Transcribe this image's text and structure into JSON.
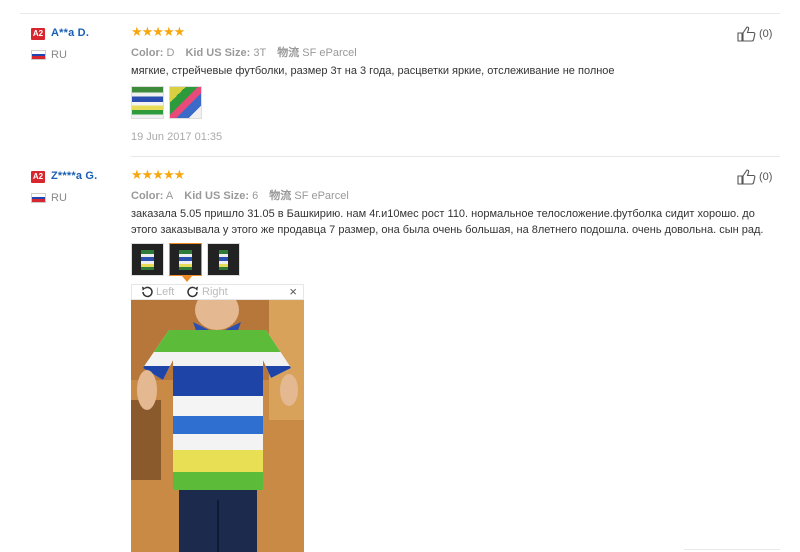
{
  "reviews": [
    {
      "badge": "A2",
      "user": "A**a D.",
      "country": "RU",
      "stars": "★★★★★",
      "color_label": "Color:",
      "color_value": "D",
      "size_label": "Kid US Size:",
      "size_value": "3T",
      "ship_label": "物流",
      "ship_value": "SF eParcel",
      "text": "мягкие, стрейчевые футболки, размер 3т на 3 года, расцветки яркие, отслеживание не полное",
      "date": "19 Jun 2017 01:35",
      "likes": "(0)"
    },
    {
      "badge": "A2",
      "user": "Z****a G.",
      "country": "RU",
      "stars": "★★★★★",
      "color_label": "Color:",
      "color_value": "A",
      "size_label": "Kid US Size:",
      "size_value": "6",
      "ship_label": "物流",
      "ship_value": "SF eParcel",
      "text": "заказала 5.05 пришло 31.05 в Башкирию. нам 4г.и10мес рост 110. нормальное телосложение.футболка сидит хорошо. до этого заказывала у этого же продавца 7 размер, она была очень большая, на 8летнего подошла. очень довольна. сын рад.",
      "likes": "(0)"
    }
  ],
  "viewer": {
    "left_label": "Left",
    "right_label": "Right",
    "close_symbol": "×"
  },
  "colors": {
    "accent": "#f7a80f",
    "badge": "#d8262e",
    "link": "#1a5fb4",
    "active_thumb": "#f08a24"
  }
}
